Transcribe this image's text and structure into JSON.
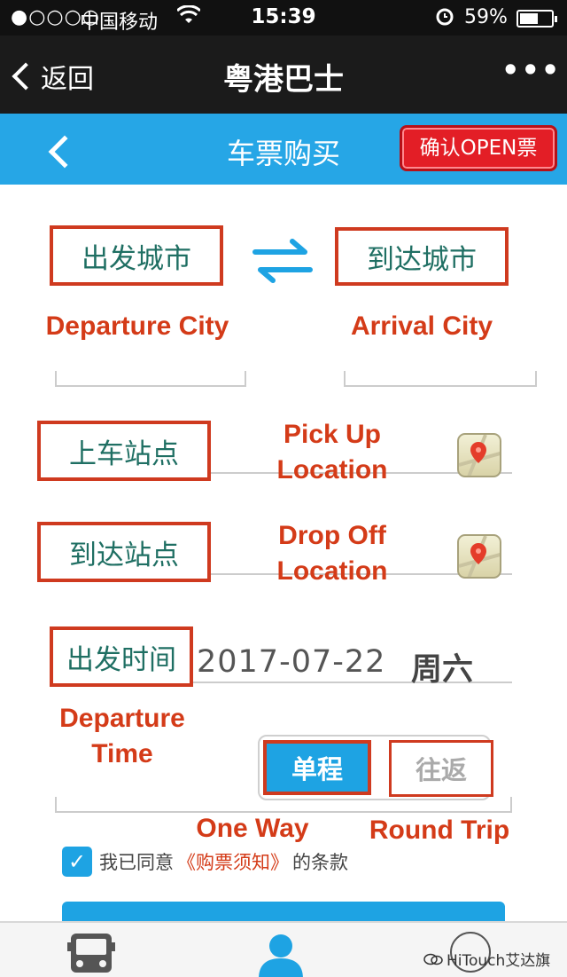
{
  "status_bar": {
    "signal": "●○○○○",
    "carrier": "中国移动",
    "time": "15:39",
    "battery_percent": "59%",
    "battery_level": 0.59
  },
  "nav": {
    "back_label": "返回",
    "title": "粤港巴士",
    "more": "•••"
  },
  "header": {
    "title": "车票购买",
    "open_ticket_button": "确认OPEN票"
  },
  "form": {
    "departure_city": {
      "label": "出发城市",
      "annotation": "Departure City"
    },
    "arrival_city": {
      "label": "到达城市",
      "annotation": "Arrival City"
    },
    "pickup": {
      "label": "上车站点",
      "annotation_line1": "Pick Up",
      "annotation_line2": "Location"
    },
    "dropoff": {
      "label": "到达站点",
      "annotation_line1": "Drop Off",
      "annotation_line2": "Location"
    },
    "departure_time": {
      "label": "出发时间",
      "annotation_line1": "Departure",
      "annotation_line2": "Time",
      "date": "2017-07-22",
      "weekday": "周六"
    },
    "trip_type": {
      "one_way": "单程",
      "round_trip": "往返",
      "one_way_annotation": "One Way",
      "round_trip_annotation": "Round Trip",
      "selected": "单程"
    },
    "agreement": {
      "checked": true,
      "prefix": "我已同意",
      "link": "《购票须知》",
      "suffix": "的条款"
    }
  },
  "watermark": "HiTouch艾达旗",
  "colors": {
    "brand_blue": "#26a6e6",
    "annotation_red": "#d43b18",
    "open_button_red": "#e31e26"
  }
}
